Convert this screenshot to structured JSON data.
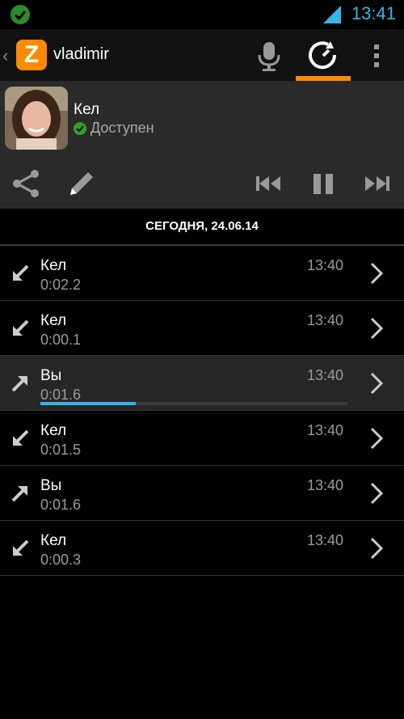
{
  "status_bar": {
    "time": "13:41"
  },
  "action_bar": {
    "title": "vladimir",
    "back_glyph": "‹"
  },
  "contact": {
    "name": "Кел",
    "status": "Доступен"
  },
  "date_header": "СЕГОДНЯ, 24.06.14",
  "messages": [
    {
      "sender": "Кел",
      "duration": "0:02.2",
      "time": "13:40",
      "direction": "incoming"
    },
    {
      "sender": "Кел",
      "duration": "0:00.1",
      "time": "13:40",
      "direction": "incoming"
    },
    {
      "sender": "Вы",
      "duration": "0:01.6",
      "time": "13:40",
      "direction": "outgoing",
      "playback_progress": 0.31
    },
    {
      "sender": "Кел",
      "duration": "0:01.5",
      "time": "13:40",
      "direction": "incoming"
    },
    {
      "sender": "Вы",
      "duration": "0:01.6",
      "time": "13:40",
      "direction": "outgoing"
    },
    {
      "sender": "Кел",
      "duration": "0:00.3",
      "time": "13:40",
      "direction": "incoming"
    }
  ],
  "colors": {
    "accent_orange": "#ff8a00",
    "accent_blue": "#33b5e5",
    "presence_green": "#2fa12f"
  }
}
